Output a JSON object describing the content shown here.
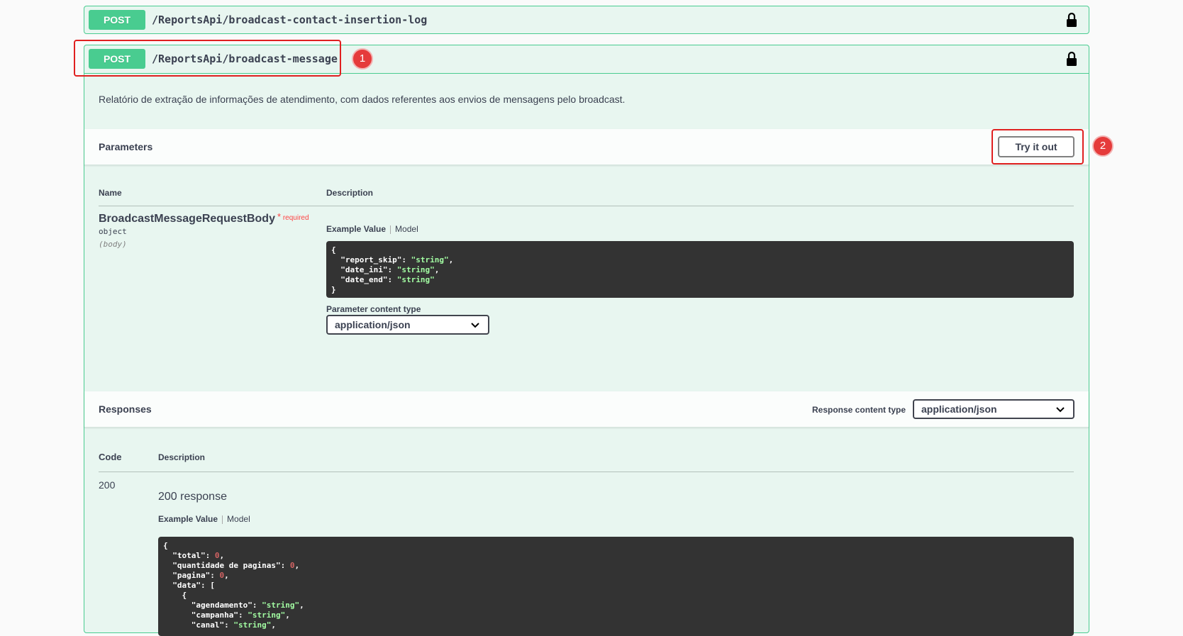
{
  "operations": [
    {
      "method": "POST",
      "path": "/ReportsApi/broadcast-contact-insertion-log"
    },
    {
      "method": "POST",
      "path": "/ReportsApi/broadcast-message",
      "description": "Relatório de extração de informações de atendimento, com dados referentes aos envios de mensagens pelo broadcast.",
      "parameters": {
        "title": "Parameters",
        "try_label": "Try it out",
        "col_name": "Name",
        "col_description": "Description",
        "param": {
          "name": "BroadcastMessageRequestBody",
          "required_star": "*",
          "required_label": "required",
          "type": "object",
          "in": "(body)"
        },
        "example_tab": "Example Value",
        "model_tab": "Model",
        "example_lines": [
          {
            "pre": "{",
            "key": "",
            "val": "",
            "post": ""
          },
          {
            "pre": "  ",
            "key": "\"report_skip\"",
            "val": "\"string\"",
            "post": ","
          },
          {
            "pre": "  ",
            "key": "\"date_ini\"",
            "val": "\"string\"",
            "post": ","
          },
          {
            "pre": "  ",
            "key": "\"date_end\"",
            "val": "\"string\"",
            "post": ""
          },
          {
            "pre": "}",
            "key": "",
            "val": "",
            "post": ""
          }
        ],
        "content_type_label": "Parameter content type",
        "content_type_value": "application/json"
      },
      "responses": {
        "title": "Responses",
        "content_type_label": "Response content type",
        "content_type_value": "application/json",
        "col_code": "Code",
        "col_description": "Description",
        "code": "200",
        "code_description": "200 response",
        "example_tab": "Example Value",
        "model_tab": "Model",
        "example_lines": [
          {
            "pre": "{",
            "key": "",
            "val": "",
            "post": "",
            "num": false
          },
          {
            "pre": "  ",
            "key": "\"total\"",
            "val": "0",
            "post": ",",
            "num": true
          },
          {
            "pre": "  ",
            "key": "\"quantidade de paginas\"",
            "val": "0",
            "post": ",",
            "num": true
          },
          {
            "pre": "  ",
            "key": "\"pagina\"",
            "val": "0",
            "post": ",",
            "num": true
          },
          {
            "pre": "  ",
            "key": "\"data\"",
            "val": "",
            "post": ": [",
            "num": false
          },
          {
            "pre": "    {",
            "key": "",
            "val": "",
            "post": "",
            "num": false
          },
          {
            "pre": "      ",
            "key": "\"agendamento\"",
            "val": "\"string\"",
            "post": ",",
            "num": false
          },
          {
            "pre": "      ",
            "key": "\"campanha\"",
            "val": "\"string\"",
            "post": ",",
            "num": false
          },
          {
            "pre": "      ",
            "key": "\"canal\"",
            "val": "\"string\"",
            "post": ",",
            "num": false
          }
        ]
      }
    }
  ],
  "annotations": [
    {
      "label": "1"
    },
    {
      "label": "2"
    }
  ],
  "colors": {
    "method": "#49cc90",
    "annotation": "#e02020",
    "code_bg": "#333333"
  },
  "icons": [
    "lock-icon",
    "chevron-down-icon"
  ]
}
